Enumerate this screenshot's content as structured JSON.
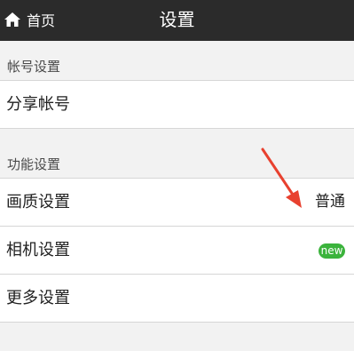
{
  "nav": {
    "back_label": "首页",
    "title": "设置",
    "back_icon": "home-icon"
  },
  "sections": [
    {
      "header": "帐号设置",
      "rows": [
        {
          "label": "分享帐号"
        }
      ]
    },
    {
      "header": "功能设置",
      "rows": [
        {
          "label": "画质设置",
          "value": "普通"
        },
        {
          "label": "相机设置",
          "badge": "new"
        },
        {
          "label": "更多设置"
        }
      ]
    }
  ],
  "colors": {
    "nav_background": "#2b2b2b",
    "page_background": "#f2f2f2",
    "badge_green": "#3bb33c",
    "annotation_arrow": "#e8412f"
  }
}
